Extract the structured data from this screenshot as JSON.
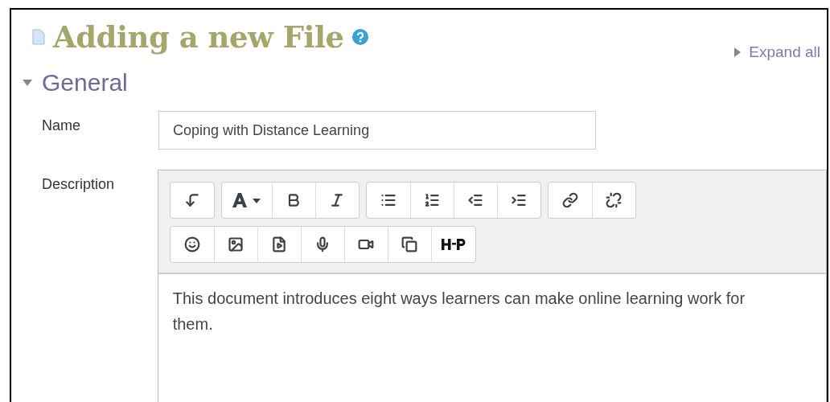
{
  "page": {
    "title": "Adding a new File",
    "expand_all": "Expand all"
  },
  "section": {
    "title": "General",
    "expanded": true
  },
  "name_field": {
    "label": "Name",
    "value": "Coping with Distance Learning"
  },
  "description": {
    "label": "Description",
    "toolbar_rows": [
      [
        [
          {
            "kind": "more"
          }
        ],
        [
          {
            "kind": "font-color"
          },
          {
            "kind": "bold"
          },
          {
            "kind": "italic"
          }
        ],
        [
          {
            "kind": "bullets"
          },
          {
            "kind": "numbers"
          },
          {
            "kind": "outdent"
          },
          {
            "kind": "indent"
          }
        ],
        [
          {
            "kind": "link"
          },
          {
            "kind": "unlink"
          }
        ]
      ],
      [
        [
          {
            "kind": "emoji"
          },
          {
            "kind": "image"
          },
          {
            "kind": "media-file"
          },
          {
            "kind": "microphone"
          },
          {
            "kind": "video"
          },
          {
            "kind": "copy"
          },
          {
            "kind": "logo"
          }
        ]
      ]
    ],
    "value": "This document introduces eight ways learners can make online learning work for them."
  }
}
